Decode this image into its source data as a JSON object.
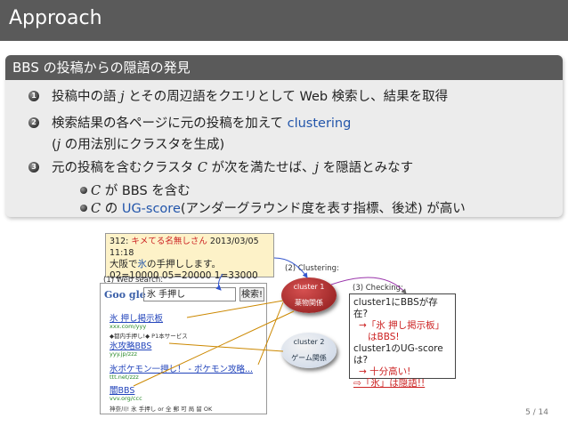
{
  "header": {
    "title": "Approach"
  },
  "block": {
    "title": "BBS の投稿からの隠語の発見",
    "items": [
      {
        "num": "1",
        "pre": "投稿中の語 ",
        "var": "j",
        "post": " とその周辺語をクエリとして Web 検索し、結果を取得"
      },
      {
        "num": "2",
        "pre": "検索結果の各ページに元の投稿を加えて ",
        "blue": "clustering",
        "line2_a": "(",
        "line2_var": "j",
        "line2_b": " の用法別にクラスタを生成)"
      },
      {
        "num": "3",
        "pre": "元の投稿を含むクラスタ ",
        "var": "C",
        "post": " が次を満たせば、",
        "var2": "j",
        "post2": " を隠語とみなす"
      }
    ],
    "subitems": [
      {
        "var": "C",
        "text": " が BBS を含む"
      },
      {
        "var": "C",
        "text_a": " の ",
        "blue": "UG-score",
        "text_b": "(アンダーグラウンド度を表す指標、後述) が高い"
      }
    ]
  },
  "post": {
    "meta_a": "312: ",
    "meta_name": "キメてる名無しさん",
    "meta_date": " 2013/03/05 11:18",
    "line1_a": "大阪で",
    "line1_ice": "氷",
    "line1_b": "の手押しします。",
    "line2": "02=10000 05=20000 1=33000"
  },
  "labels": {
    "web_search": "(1) Web search:",
    "clustering": "(2) Clustering:",
    "checking": "(3) Checking:"
  },
  "serp": {
    "logo": "Goo gle",
    "query": "氷 手押し",
    "button": "検索!",
    "results": [
      {
        "title": "氷 押し掲示板",
        "url": "xxx.com/yyy",
        "snippet": "◆都内手押し!◆ P1本サービス"
      },
      {
        "title": "氷攻略BBS",
        "url": "yyy.jp/zzz",
        "snippet": ""
      },
      {
        "title": "氷ポケモン一押し！ - ポケモン攻略...",
        "url": "ttt.net/zzz",
        "snippet": ""
      },
      {
        "title": "闇BBS",
        "url": "vvv.org/ccc",
        "snippet": "神奈川! 氷 手押し or 全 郵 可 局 留 OK"
      }
    ]
  },
  "clusters": [
    {
      "name": "cluster 1",
      "tag": "薬物関係"
    },
    {
      "name": "cluster 2",
      "tag": "ゲーム関係"
    }
  ],
  "check": {
    "l1": "cluster1にBBSが存在?",
    "l2": "→「氷 押し掲示板」",
    "l3": "はBBS!",
    "l4": "cluster1のUG-scoreは?",
    "l5": "→ 十分高い!",
    "l6": "⇨「氷」は隠語!!"
  },
  "colors": {
    "accent_red": "#cc2222",
    "accent_blue": "#2255aa",
    "bar_gray": "#5a5a5a",
    "cluster1": "#b03030",
    "cluster2": "#3a6fb0"
  },
  "footer": {
    "page": "5 / 14"
  }
}
